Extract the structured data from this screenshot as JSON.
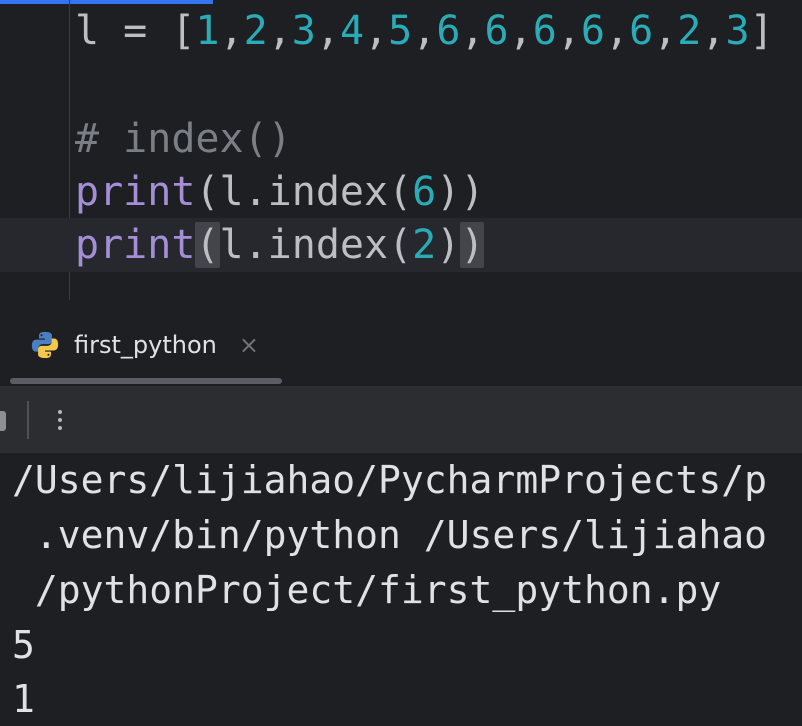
{
  "editor": {
    "lines": [
      {
        "tokens": [
          {
            "text": "l = [",
            "kind": "plain"
          },
          {
            "text": "1",
            "kind": "num"
          },
          {
            "text": ",",
            "kind": "plain"
          },
          {
            "text": "2",
            "kind": "num"
          },
          {
            "text": ",",
            "kind": "plain"
          },
          {
            "text": "3",
            "kind": "num"
          },
          {
            "text": ",",
            "kind": "plain"
          },
          {
            "text": "4",
            "kind": "num"
          },
          {
            "text": ",",
            "kind": "plain"
          },
          {
            "text": "5",
            "kind": "num"
          },
          {
            "text": ",",
            "kind": "plain"
          },
          {
            "text": "6",
            "kind": "num"
          },
          {
            "text": ",",
            "kind": "plain"
          },
          {
            "text": "6",
            "kind": "num"
          },
          {
            "text": ",",
            "kind": "plain"
          },
          {
            "text": "6",
            "kind": "num"
          },
          {
            "text": ",",
            "kind": "plain"
          },
          {
            "text": "6",
            "kind": "num"
          },
          {
            "text": ",",
            "kind": "plain"
          },
          {
            "text": "6",
            "kind": "num"
          },
          {
            "text": ",",
            "kind": "plain"
          },
          {
            "text": "2",
            "kind": "num"
          },
          {
            "text": ",",
            "kind": "plain"
          },
          {
            "text": "3",
            "kind": "num"
          },
          {
            "text": "]",
            "kind": "plain"
          }
        ]
      },
      {
        "tokens": []
      },
      {
        "tokens": [
          {
            "text": "# index()",
            "kind": "comment"
          }
        ]
      },
      {
        "tokens": [
          {
            "text": "print",
            "kind": "fn"
          },
          {
            "text": "(l.index(",
            "kind": "plain"
          },
          {
            "text": "6",
            "kind": "num"
          },
          {
            "text": "))",
            "kind": "plain"
          }
        ]
      },
      {
        "current": true,
        "tokens": [
          {
            "text": "print",
            "kind": "fn"
          },
          {
            "text": "(",
            "kind": "plain",
            "highlight": true
          },
          {
            "text": "l.index(",
            "kind": "plain"
          },
          {
            "text": "2",
            "kind": "num"
          },
          {
            "text": ")",
            "kind": "plain"
          },
          {
            "text": ")",
            "kind": "plain",
            "highlight": true
          }
        ]
      }
    ]
  },
  "run_window": {
    "tab": {
      "icon": "python-icon",
      "label": "first_python",
      "close_icon": "close-icon",
      "close_glyph": "×"
    },
    "toolbar": {
      "menu_icon": "more-vertical-icon"
    },
    "console_lines": [
      "/Users/lijiahao/PycharmProjects/p",
      " .venv/bin/python /Users/lijiahao",
      " /pythonProject/first_python.py",
      "5",
      "1"
    ]
  },
  "colors": {
    "background": "#1e1f22",
    "number": "#2aacb8",
    "function": "#a48fd6",
    "comment": "#7a7e85",
    "text": "#bcbec4",
    "accent": "#3574f0"
  }
}
